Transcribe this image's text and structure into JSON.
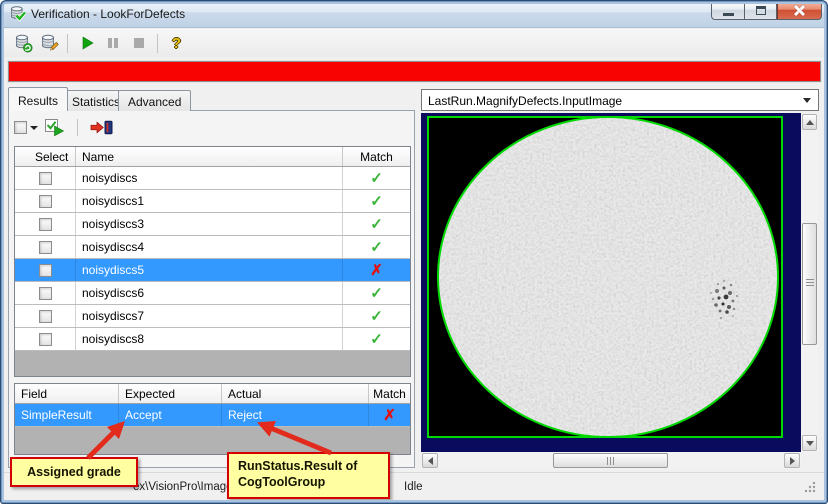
{
  "window": {
    "title": "Verification - LookForDefects"
  },
  "toolbar": {
    "buttons": [
      {
        "id": "load-results",
        "icon": "database-refresh-icon"
      },
      {
        "id": "edit-results",
        "icon": "database-edit-icon"
      },
      {
        "id": "run",
        "icon": "play-icon"
      },
      {
        "id": "pause",
        "icon": "pause-icon"
      },
      {
        "id": "stop",
        "icon": "stop-icon"
      },
      {
        "id": "help",
        "icon": "help-icon"
      }
    ]
  },
  "tabs": [
    {
      "label": "Results",
      "active": true
    },
    {
      "label": "Statistics",
      "active": false
    },
    {
      "label": "Advanced",
      "active": false
    }
  ],
  "mini_toolbar": [
    {
      "id": "select-all-dropdown",
      "icon": "checkbox-dropdown-icon"
    },
    {
      "id": "run-checked",
      "icon": "checked-run-icon"
    },
    {
      "id": "export-to-database",
      "icon": "arrow-database-icon"
    }
  ],
  "results_table": {
    "columns": [
      "Select",
      "Name",
      "Match"
    ],
    "rows": [
      {
        "name": "noisydiscs",
        "checked": false,
        "match": true,
        "selected": false
      },
      {
        "name": "noisydiscs1",
        "checked": false,
        "match": true,
        "selected": false
      },
      {
        "name": "noisydiscs3",
        "checked": false,
        "match": true,
        "selected": false
      },
      {
        "name": "noisydiscs4",
        "checked": false,
        "match": true,
        "selected": false
      },
      {
        "name": "noisydiscs5",
        "checked": false,
        "match": false,
        "selected": true
      },
      {
        "name": "noisydiscs6",
        "checked": false,
        "match": true,
        "selected": false
      },
      {
        "name": "noisydiscs7",
        "checked": false,
        "match": true,
        "selected": false
      },
      {
        "name": "noisydiscs8",
        "checked": false,
        "match": true,
        "selected": false
      }
    ]
  },
  "detail_table": {
    "columns": [
      "Field",
      "Expected",
      "Actual",
      "Match"
    ],
    "rows": [
      {
        "field": "SimpleResult",
        "expected": "Accept",
        "actual": "Reject",
        "match": false,
        "selected": true
      }
    ]
  },
  "image_panel": {
    "display_selector": "LastRun.MagnifyDefects.InputImage"
  },
  "status_bar": {
    "path_fragment": "ex\\VisionPro\\Images",
    "state_fragment": "Idle"
  },
  "callouts": [
    {
      "text": "Assigned grade"
    },
    {
      "text": "RunStatus.Result of CogToolGroup"
    }
  ],
  "icons": {
    "check_glyph": "✓",
    "cross_glyph": "✗",
    "help_glyph": "?"
  },
  "colors": {
    "selection_blue": "#3399ff",
    "match_green": "#38b438",
    "mismatch_red": "#e01212",
    "alert_red": "#f90202",
    "callout_yellow": "#ffffa2",
    "callout_border": "#d40000",
    "image_background": "#0b0b5e",
    "overlay_green": "#00d900"
  }
}
